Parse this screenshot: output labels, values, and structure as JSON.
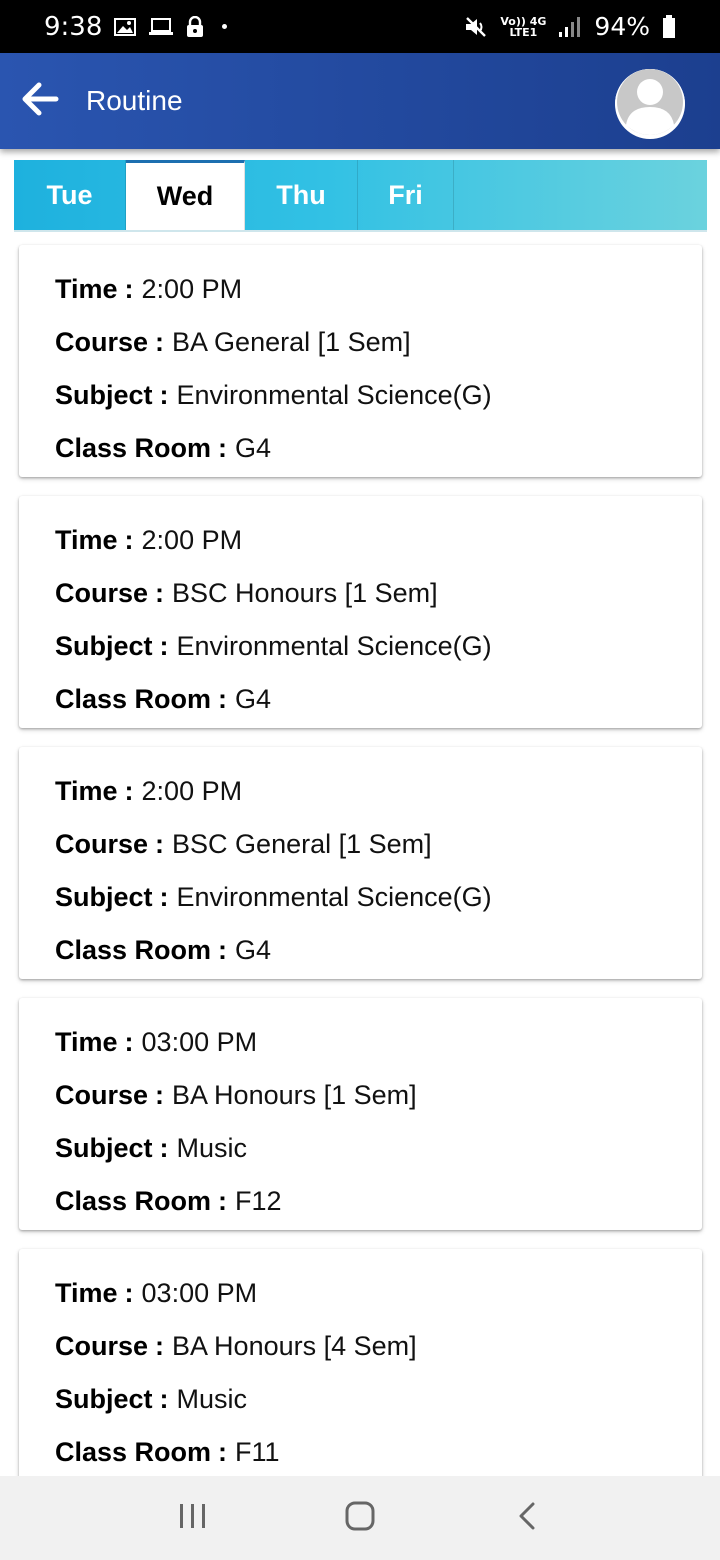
{
  "status_bar": {
    "time": "9:38",
    "battery": "94%",
    "net_top": "Vo)) 4G",
    "net_bottom": "LTE1"
  },
  "header": {
    "title": "Routine",
    "back_icon": "arrow-left-icon",
    "avatar_icon": "user-avatar-icon"
  },
  "tabs": [
    {
      "label": "Tue",
      "active": false
    },
    {
      "label": "Wed",
      "active": true
    },
    {
      "label": "Thu",
      "active": false
    },
    {
      "label": "Fri",
      "active": false
    }
  ],
  "labels": {
    "time": "Time",
    "course": "Course",
    "subject": "Subject",
    "room": "Class Room",
    "separator": ":"
  },
  "entries": [
    {
      "time": "2:00 PM",
      "course": "BA General [1 Sem]",
      "subject": "Environmental Science(G)",
      "room": "G4"
    },
    {
      "time": "2:00 PM",
      "course": "BSC Honours [1 Sem]",
      "subject": "Environmental Science(G)",
      "room": "G4"
    },
    {
      "time": "2:00 PM",
      "course": "BSC General [1 Sem]",
      "subject": "Environmental Science(G)",
      "room": "G4"
    },
    {
      "time": "03:00 PM",
      "course": "BA Honours [1 Sem]",
      "subject": "Music",
      "room": "F12"
    },
    {
      "time": "03:00 PM",
      "course": "BA Honours [4 Sem]",
      "subject": "Music",
      "room": "F11"
    }
  ],
  "colors": {
    "app_bar": "#2a55b0",
    "tab_bar": "#1eb1de",
    "active_tab_bg": "#ffffff"
  },
  "nav": {
    "recents_icon": "recents-icon",
    "home_icon": "home-icon",
    "back_icon": "back-chevron-icon"
  }
}
